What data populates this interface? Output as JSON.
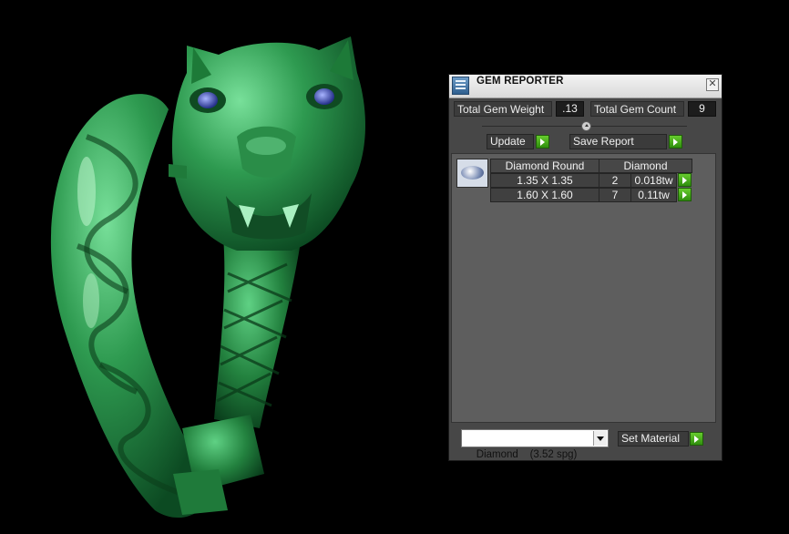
{
  "window": {
    "title": "GEM REPORTER",
    "close_glyph": "✕"
  },
  "totals": {
    "weight_label": "Total Gem Weight",
    "weight_value": ".13",
    "count_label": "Total Gem Count",
    "count_value": "9"
  },
  "actions": {
    "update_label": "Update",
    "save_label": "Save Report"
  },
  "report": {
    "header": {
      "shape": "Diamond Round",
      "material": "Diamond"
    },
    "rows": [
      {
        "size": "1.35 X 1.35",
        "count": "2",
        "weight": "0.018tw"
      },
      {
        "size": "1.60 X 1.60",
        "count": "7",
        "weight": "0.11tw"
      }
    ]
  },
  "material": {
    "selected": "Diamond    (3.52 spg)",
    "set_label": "Set Material"
  },
  "icons": {
    "app": "gem-reporter-app-icon",
    "close": "close-icon",
    "go": "green-arrow-icon",
    "dropdown": "chevron-down-icon",
    "gem": "round-gem-icon"
  },
  "colors": {
    "model": "#2f9a50",
    "panel": "#474747",
    "go_button": "#4fb81f"
  }
}
